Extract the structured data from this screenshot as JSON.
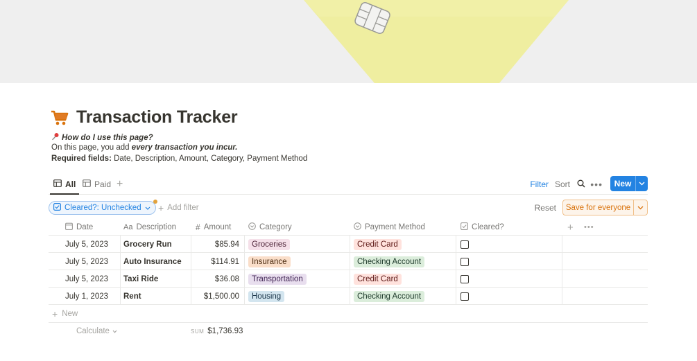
{
  "page": {
    "title": "Transaction Tracker",
    "icon": "shopping-cart-icon",
    "help_question": "How do I use this page?",
    "line2_prefix": "On this page, you add ",
    "line2_emph": "every transaction you incur.",
    "line3_label": "Required fields:",
    "line3_rest": " Date, Description, Amount, Category, Payment Method"
  },
  "views": {
    "tabs": [
      {
        "label": "All",
        "icon": "table-icon",
        "active": true
      },
      {
        "label": "Paid",
        "icon": "table-icon",
        "active": false
      }
    ],
    "filter_label": "Filter",
    "sort_label": "Sort",
    "new_label": "New"
  },
  "filterbar": {
    "chip_label": "Cleared?: Unchecked",
    "add_filter_label": "Add filter",
    "reset_label": "Reset",
    "save_label": "Save for everyone"
  },
  "table": {
    "headers": {
      "date": "Date",
      "description": "Description",
      "amount": "Amount",
      "category": "Category",
      "payment": "Payment Method",
      "cleared": "Cleared?"
    },
    "rows": [
      {
        "date": "July 5, 2023",
        "description": "Grocery Run",
        "amount": "$85.94",
        "category": "Groceries",
        "payment": "Credit Card",
        "cleared": false
      },
      {
        "date": "July 5, 2023",
        "description": "Auto Insurance",
        "amount": "$114.91",
        "category": "Insurance",
        "payment": "Checking Account",
        "cleared": false
      },
      {
        "date": "July 5, 2023",
        "description": "Taxi Ride",
        "amount": "$36.08",
        "category": "Transportation",
        "payment": "Credit Card",
        "cleared": false
      },
      {
        "date": "July 1, 2023",
        "description": "Rent",
        "amount": "$1,500.00",
        "category": "Housing",
        "payment": "Checking Account",
        "cleared": false
      }
    ],
    "new_row_label": "New",
    "calculate_label": "Calculate",
    "sum_label": "SUM",
    "sum_value": "$1,736.93"
  },
  "tag_colors": {
    "Groceries": {
      "bg": "#f5e0e9",
      "fg": "#4c2337"
    },
    "Insurance": {
      "bg": "#fadec9",
      "fg": "#49290e"
    },
    "Transportation": {
      "bg": "#e8deee",
      "fg": "#412454"
    },
    "Housing": {
      "bg": "#d3e5ef",
      "fg": "#183347"
    },
    "Credit Card": {
      "bg": "#ffe2dd",
      "fg": "#5d1715"
    },
    "Checking Account": {
      "bg": "#dbeddb",
      "fg": "#1c3829"
    }
  },
  "colors": {
    "accent": "#2383e2",
    "save_orange": "#d9730d",
    "cover_card": "#eeec9a"
  }
}
